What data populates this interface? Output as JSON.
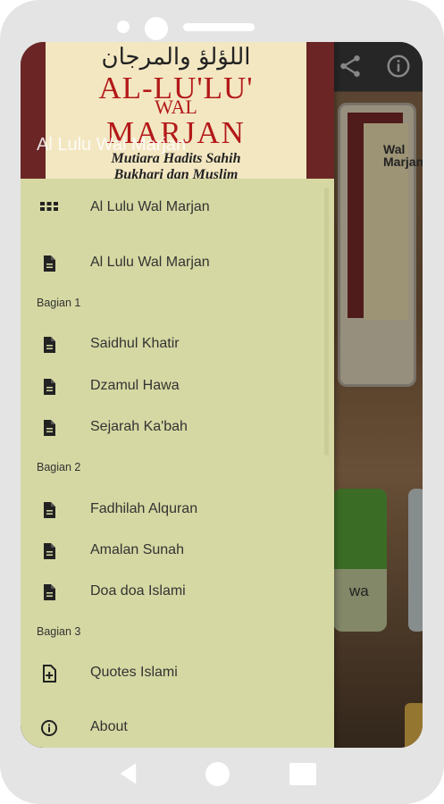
{
  "header": {
    "book_arabic": "اللؤلؤ والمرجان",
    "book_title_line1": "AL-LU'LU'",
    "book_title_line2": "WAL",
    "book_title_line3": "MARJAN",
    "book_subtitle_line1": "Mutiara Hadits Sahih",
    "book_subtitle_line2": "Bukhari dan Muslim",
    "app_title": "Al Lulu Wal Marjan"
  },
  "background_app": {
    "card_title_line1": "Wal",
    "card_title_line2": "Marjan",
    "tile_text": "wa"
  },
  "menu": {
    "items": [
      {
        "label": "Al Lulu Wal Marjan",
        "icon": "grid-icon"
      },
      {
        "label": "Al Lulu Wal Marjan",
        "icon": "document-icon"
      },
      {
        "label": "Saidhul Khatir",
        "icon": "document-icon"
      },
      {
        "label": "Dzamul Hawa",
        "icon": "document-icon"
      },
      {
        "label": "Sejarah Ka'bah",
        "icon": "document-icon"
      },
      {
        "label": "Fadhilah Alquran",
        "icon": "document-icon"
      },
      {
        "label": "Amalan Sunah",
        "icon": "document-icon"
      },
      {
        "label": "Doa doa Islami",
        "icon": "document-icon"
      },
      {
        "label": "Quotes Islami",
        "icon": "add-document-icon"
      },
      {
        "label": "About",
        "icon": "info-icon"
      }
    ],
    "sections": [
      "Bagian 1",
      "Bagian 2",
      "Bagian 3"
    ]
  },
  "colors": {
    "drawer_bg": "#d5d8a2",
    "header_bg": "#6b2525",
    "book_title": "#b31919"
  }
}
